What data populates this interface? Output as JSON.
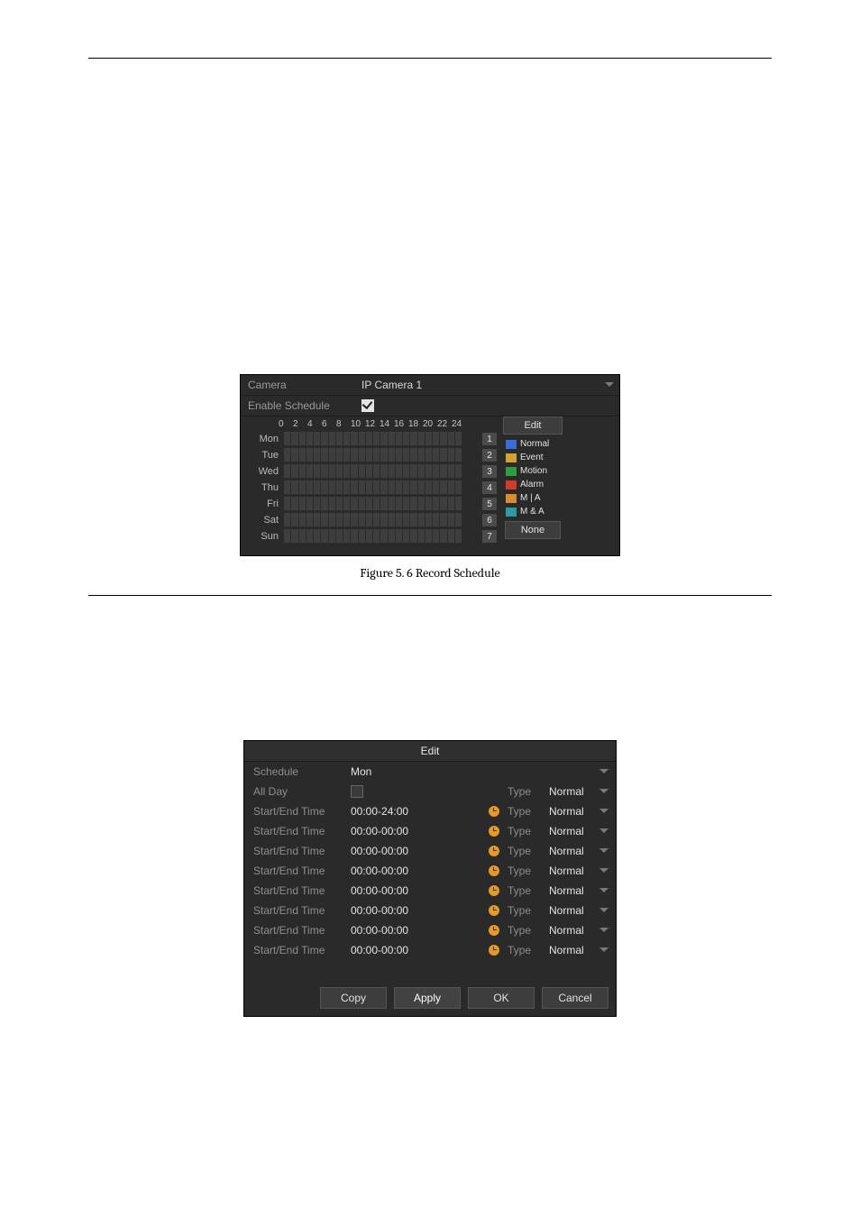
{
  "fig1": {
    "caption_prefix": "Figure 5. 6",
    "caption_title": "Record Schedule",
    "camera_label": "Camera",
    "camera_value": "IP Camera 1",
    "enable_label": "Enable Schedule",
    "enable_checked": true,
    "ticks": [
      "0",
      "2",
      "4",
      "6",
      "8",
      "10",
      "12",
      "14",
      "16",
      "18",
      "20",
      "22",
      "24"
    ],
    "days": [
      "Mon",
      "Tue",
      "Wed",
      "Thu",
      "Fri",
      "Sat",
      "Sun"
    ],
    "series_numbers": [
      "1",
      "2",
      "3",
      "4",
      "5",
      "6",
      "7"
    ],
    "edit_btn": "Edit",
    "legend": {
      "normal": "Normal",
      "event": "Event",
      "motion": "Motion",
      "alarm": "Alarm",
      "mia": "M | A",
      "maa": "M & A"
    },
    "none_btn": "None"
  },
  "fig2": {
    "title": "Edit",
    "schedule_label": "Schedule",
    "schedule_value": "Mon",
    "allday_label": "All Day",
    "allday_checked": false,
    "type_label": "Type",
    "rows": [
      {
        "label": "Start/End Time",
        "time": "00:00-24:00",
        "type": "Normal"
      },
      {
        "label": "Start/End Time",
        "time": "00:00-00:00",
        "type": "Normal"
      },
      {
        "label": "Start/End Time",
        "time": "00:00-00:00",
        "type": "Normal"
      },
      {
        "label": "Start/End Time",
        "time": "00:00-00:00",
        "type": "Normal"
      },
      {
        "label": "Start/End Time",
        "time": "00:00-00:00",
        "type": "Normal"
      },
      {
        "label": "Start/End Time",
        "time": "00:00-00:00",
        "type": "Normal"
      },
      {
        "label": "Start/End Time",
        "time": "00:00-00:00",
        "type": "Normal"
      },
      {
        "label": "Start/End Time",
        "time": "00:00-00:00",
        "type": "Normal"
      }
    ],
    "allday_type": "Normal",
    "btn_copy": "Copy",
    "btn_apply": "Apply",
    "btn_ok": "OK",
    "btn_cancel": "Cancel"
  }
}
